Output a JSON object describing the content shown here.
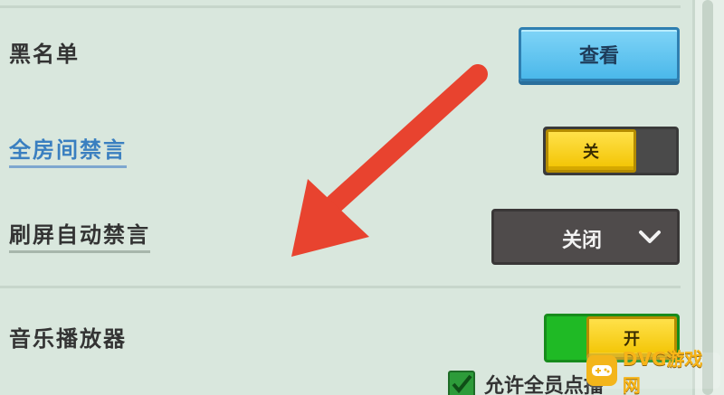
{
  "settings": {
    "blacklist": {
      "label": "黑名单",
      "button_label": "查看"
    },
    "mute_all": {
      "label": "全房间禁言",
      "toggle_label": "关",
      "state": "off"
    },
    "auto_mute_spam": {
      "label": "刷屏自动禁言",
      "selected": "关闭"
    },
    "music_player": {
      "label": "音乐播放器",
      "toggle_label": "开",
      "state": "on"
    },
    "allow_row": {
      "label": "允许全员点播",
      "checked": true
    }
  },
  "watermark": {
    "text": "DVG游戏网"
  },
  "colors": {
    "background": "#d9e7dd",
    "button_blue": "#4bb8ea",
    "toggle_yellow": "#f2c300",
    "toggle_green": "#1fba25",
    "arrow_red": "#e8432f"
  },
  "icons": {
    "dropdown": "chevron-down-icon",
    "annotation": "red-arrow-icon",
    "checkbox": "checkmark-icon",
    "watermark": "gamepad-icon"
  }
}
